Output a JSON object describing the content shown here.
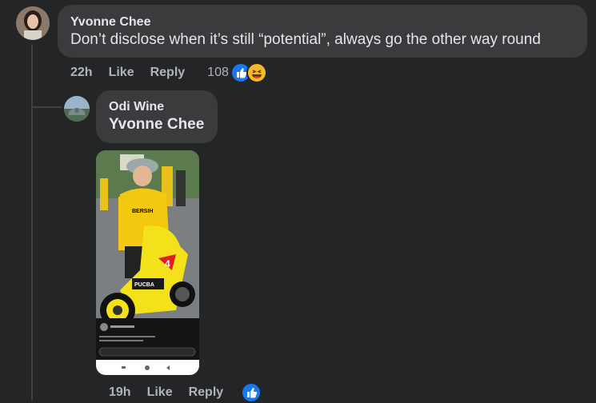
{
  "comment": {
    "author": "Yvonne Chee",
    "text": "Don’t disclose when it’s still “potential”, always go the other way round",
    "time": "22h",
    "like_label": "Like",
    "reply_label": "Reply",
    "reaction_count": "108",
    "reactions": [
      "like-icon",
      "haha-icon"
    ]
  },
  "reply": {
    "author": "Odi Wine",
    "mention": "Yvonne Chee",
    "time": "19h",
    "like_label": "Like",
    "reply_label": "Reply",
    "reactions": [
      "like-icon"
    ],
    "image": {
      "shirt_text": "BERSIH",
      "bike_text": "PUCBA",
      "number_badge": "4"
    }
  },
  "colors": {
    "background": "#242526",
    "bubble": "#3a3b3c",
    "like_blue": "#1877f2",
    "haha_yellow": "#f7b928"
  }
}
